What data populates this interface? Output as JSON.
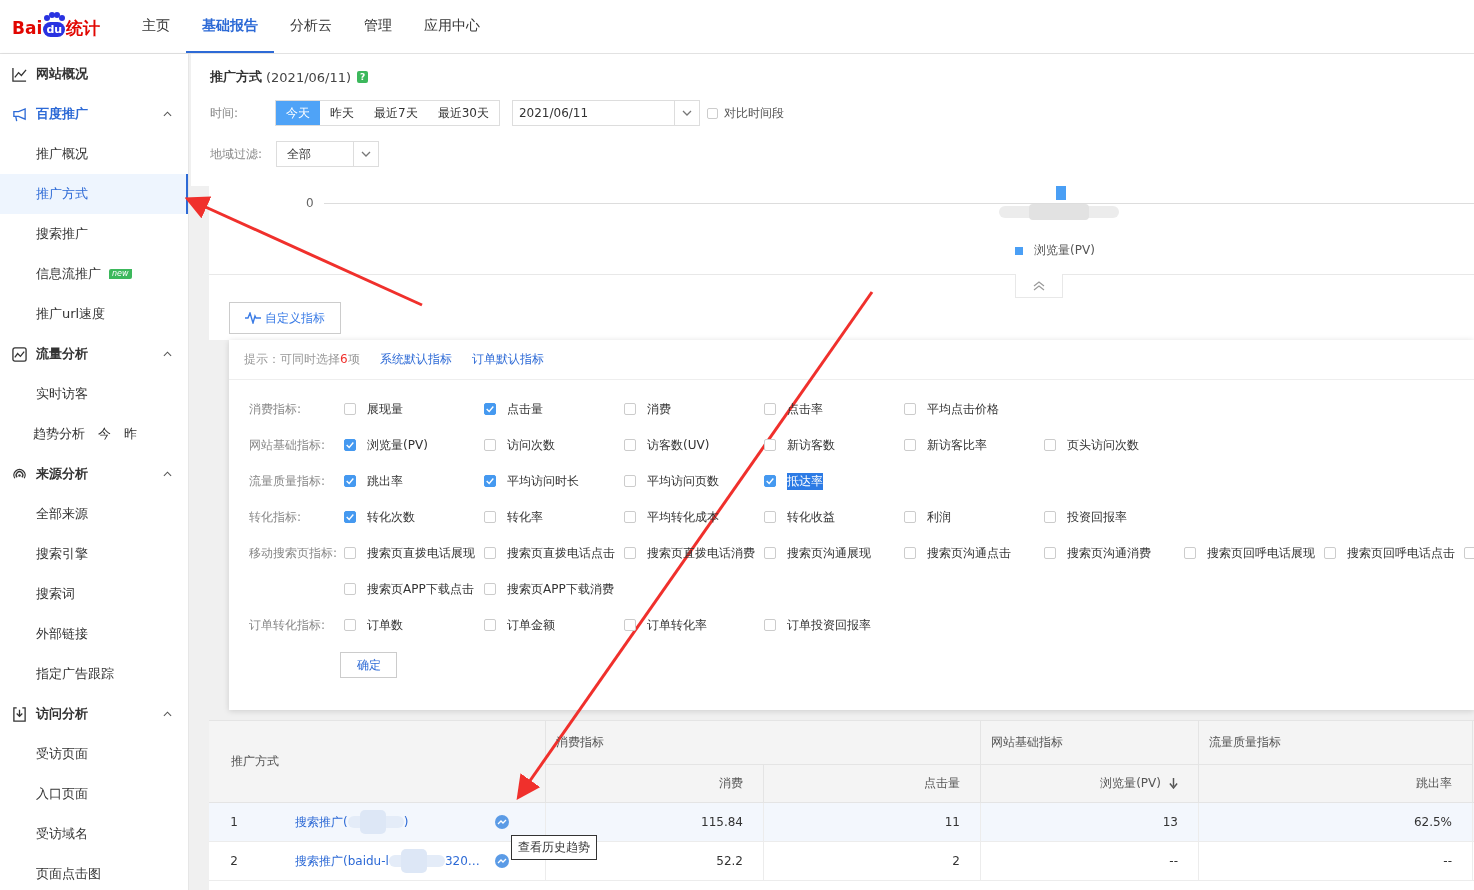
{
  "logo": {
    "parts": [
      "Bai",
      "du",
      "统计"
    ]
  },
  "nav": [
    {
      "label": "主页",
      "selected": false
    },
    {
      "label": "基础报告",
      "selected": true
    },
    {
      "label": "分析云",
      "selected": false
    },
    {
      "label": "管理",
      "selected": false
    },
    {
      "label": "应用中心",
      "selected": false
    }
  ],
  "sidebar": [
    {
      "title": "网站概况",
      "kind": "link",
      "active": false
    },
    {
      "title": "百度推广",
      "kind": "group",
      "active": true,
      "expanded": true,
      "items": [
        {
          "label": "推广概况",
          "selected": false
        },
        {
          "label": "推广方式",
          "selected": true
        },
        {
          "label": "搜索推广",
          "selected": false
        },
        {
          "label": "信息流推广",
          "selected": false,
          "badge": "new"
        },
        {
          "label": "推广url速度",
          "selected": false
        }
      ]
    },
    {
      "title": "流量分析",
      "kind": "group",
      "active": false,
      "expanded": true,
      "items": [
        {
          "label": "实时访客",
          "selected": false
        },
        {
          "label": "趋势分析",
          "selected": false,
          "extras": [
            "今",
            "昨"
          ]
        }
      ]
    },
    {
      "title": "来源分析",
      "kind": "group",
      "active": false,
      "expanded": true,
      "items": [
        {
          "label": "全部来源",
          "selected": false
        },
        {
          "label": "搜索引擎",
          "selected": false
        },
        {
          "label": "搜索词",
          "selected": false
        },
        {
          "label": "外部链接",
          "selected": false
        },
        {
          "label": "指定广告跟踪",
          "selected": false
        }
      ]
    },
    {
      "title": "访问分析",
      "kind": "group",
      "active": false,
      "expanded": true,
      "items": [
        {
          "label": "受访页面",
          "selected": false
        },
        {
          "label": "入口页面",
          "selected": false
        },
        {
          "label": "受访域名",
          "selected": false
        },
        {
          "label": "页面点击图",
          "selected": false
        }
      ]
    }
  ],
  "page": {
    "title": "推广方式",
    "date": "(2021/06/11)",
    "help": "?"
  },
  "filters": {
    "time_label": "时间:",
    "ranges": [
      {
        "label": "今天",
        "selected": true
      },
      {
        "label": "昨天",
        "selected": false
      },
      {
        "label": "最近7天",
        "selected": false
      },
      {
        "label": "最近30天",
        "selected": false
      }
    ],
    "date_value": "2021/06/11",
    "compare": {
      "label": "对比时间段",
      "checked": false
    },
    "region_label": "地域过滤:",
    "region_value": "全部"
  },
  "chart": {
    "axis_label": "0",
    "legend": {
      "label": "浏览量(PV)",
      "color": "#4a9ff5"
    }
  },
  "custom_button": "自定义指标",
  "metrics_panel": {
    "hint_prefix": "提示：可同时选择",
    "hint_count": "6",
    "hint_suffix": "项",
    "links": [
      "系统默认指标",
      "订单默认指标"
    ],
    "groups": [
      {
        "label": "消费指标:",
        "rows": [
          [
            {
              "label": "展现量",
              "checked": false
            },
            {
              "label": "点击量",
              "checked": true
            },
            {
              "label": "消费",
              "checked": false
            },
            {
              "label": "点击率",
              "checked": false
            },
            {
              "label": "平均点击价格",
              "checked": false
            }
          ]
        ]
      },
      {
        "label": "网站基础指标:",
        "rows": [
          [
            {
              "label": "浏览量(PV)",
              "checked": true
            },
            {
              "label": "访问次数",
              "checked": false
            },
            {
              "label": "访客数(UV)",
              "checked": false
            },
            {
              "label": "新访客数",
              "checked": false
            },
            {
              "label": "新访客比率",
              "checked": false
            },
            {
              "label": "页头访问次数",
              "checked": false
            }
          ]
        ]
      },
      {
        "label": "流量质量指标:",
        "rows": [
          [
            {
              "label": "跳出率",
              "checked": true
            },
            {
              "label": "平均访问时长",
              "checked": true
            },
            {
              "label": "平均访问页数",
              "checked": false
            },
            {
              "label": "抵达率",
              "checked": true,
              "highlighted": true
            }
          ]
        ]
      },
      {
        "label": "转化指标:",
        "rows": [
          [
            {
              "label": "转化次数",
              "checked": true
            },
            {
              "label": "转化率",
              "checked": false
            },
            {
              "label": "平均转化成本",
              "checked": false
            },
            {
              "label": "转化收益",
              "checked": false
            },
            {
              "label": "利润",
              "checked": false
            },
            {
              "label": "投资回报率",
              "checked": false
            }
          ]
        ]
      },
      {
        "label": "移动搜索页指标:",
        "rows": [
          [
            {
              "label": "搜索页直拨电话展现",
              "checked": false
            },
            {
              "label": "搜索页直拨电话点击",
              "checked": false
            },
            {
              "label": "搜索页直拨电话消费",
              "checked": false
            },
            {
              "label": "搜索页沟通展现",
              "checked": false
            },
            {
              "label": "搜索页沟通点击",
              "checked": false
            },
            {
              "label": "搜索页沟通消费",
              "checked": false
            },
            {
              "label": "搜索页回呼电话展现",
              "checked": false
            },
            {
              "label": "搜索页回呼电话点击",
              "checked": false
            },
            {
              "checked": false
            }
          ],
          [
            {
              "label": "搜索页APP下载点击",
              "checked": false
            },
            {
              "label": "搜索页APP下载消费",
              "checked": false
            }
          ]
        ]
      },
      {
        "label": "订单转化指标:",
        "rows": [
          [
            {
              "label": "订单数",
              "checked": false
            },
            {
              "label": "订单金额",
              "checked": false
            },
            {
              "label": "订单转化率",
              "checked": false
            },
            {
              "label": "订单投资回报率",
              "checked": false
            }
          ]
        ]
      }
    ],
    "confirm": "确定"
  },
  "table": {
    "first_column": "推广方式",
    "groups": [
      {
        "label": "消费指标"
      },
      {
        "label": "网站基础指标"
      },
      {
        "label": "流量质量指标"
      }
    ],
    "columns": [
      {
        "label": "消费",
        "sorted": false
      },
      {
        "label": "点击量",
        "sorted": false
      },
      {
        "label": "浏览量(PV)",
        "sorted": true
      },
      {
        "label": "跳出率",
        "sorted": false
      }
    ],
    "rows": [
      {
        "index": "1",
        "name_start": "搜索推广(",
        "name_end": ")",
        "values": [
          "115.84",
          "11",
          "13",
          "62.5%"
        ],
        "selected": true
      },
      {
        "index": "2",
        "name_start": "搜索推广(baidu-l",
        "name_end": "320…",
        "values": [
          "52.2",
          "2",
          "--",
          "--"
        ],
        "selected": false
      }
    ]
  },
  "tooltip": "查看历史趋势"
}
